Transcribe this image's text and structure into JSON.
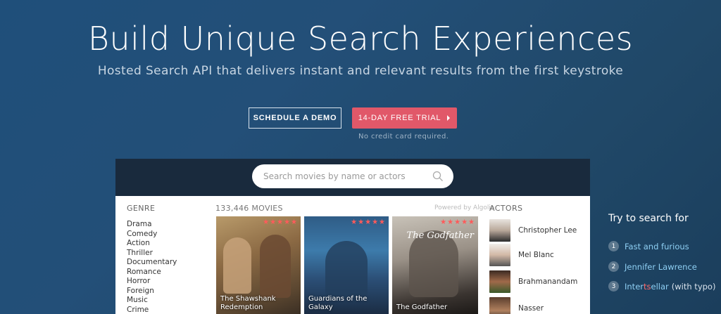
{
  "hero": {
    "title": "Build Unique Search Experiences",
    "subtitle": "Hosted Search API that delivers instant and relevant results from the first keystroke"
  },
  "buttons": {
    "demo_label": "SCHEDULE A DEMO",
    "trial_label": "14-DAY FREE TRIAL",
    "trial_icon": "chevron-right-icon",
    "trial_color": "#e15869",
    "trial_note": "No credit card required."
  },
  "demo": {
    "search_placeholder": "Search movies by name or actors",
    "genre_title": "GENRE",
    "genres": [
      "Drama",
      "Comedy",
      "Action",
      "Thriller",
      "Documentary",
      "Romance",
      "Horror",
      "Foreign",
      "Music",
      "Crime"
    ],
    "movies_count": "133,446 MOVIES",
    "powered_by": "Powered by Algolia",
    "stars": "★★★★★",
    "movies": [
      {
        "title_line1": "The Shawshank",
        "title_line2": "Redemption"
      },
      {
        "title_line1": "Guardians of the Galaxy",
        "title_line2": ""
      },
      {
        "title_line1": "The Godfather",
        "title_line2": "",
        "logo": "The Godfather"
      }
    ],
    "actors_title": "ACTORS",
    "actors": [
      {
        "name": "Christopher Lee"
      },
      {
        "name": "Mel Blanc"
      },
      {
        "name": "Brahmanandam"
      },
      {
        "name": "Nasser"
      }
    ]
  },
  "try": {
    "title": "Try to search for",
    "items": [
      {
        "num": "1",
        "text": "Fast and furious"
      },
      {
        "num": "2",
        "text": "Jennifer Lawrence"
      },
      {
        "num": "3",
        "text_a": "Inter",
        "text_typo": "ts",
        "text_b": "ellar",
        "note": "(with typo)"
      }
    ]
  }
}
